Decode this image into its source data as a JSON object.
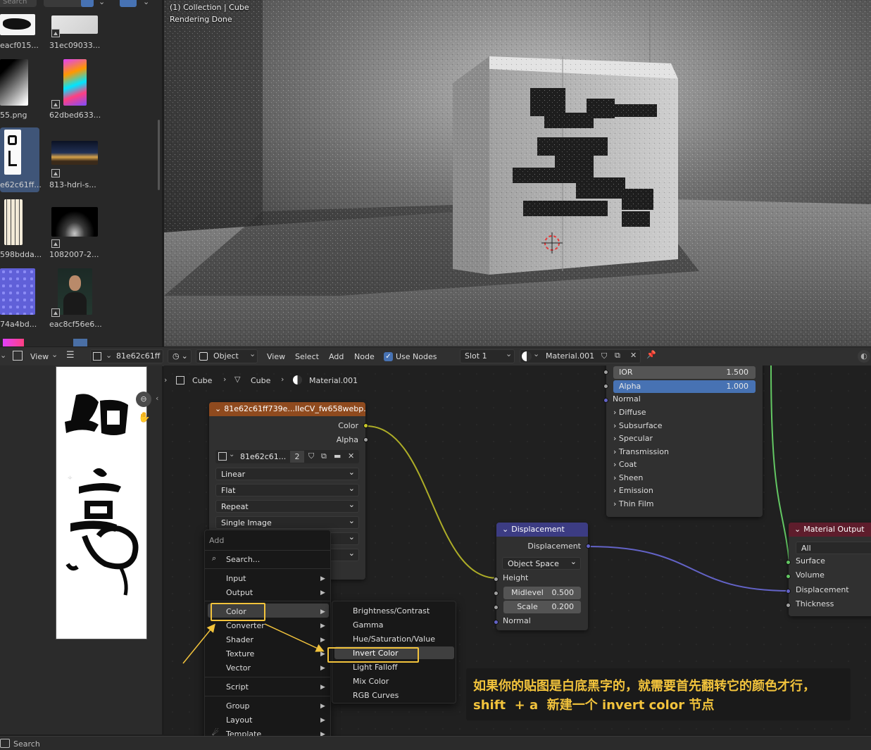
{
  "file_browser": {
    "search_placeholder": "Search",
    "tiles": [
      {
        "label": "eacf015...",
        "thumb": "ink-brush"
      },
      {
        "label": "31ec09033...",
        "thumb": "paper-texture"
      },
      {
        "label": "55.png",
        "thumb": "gradient"
      },
      {
        "label": "62dbed633...",
        "thumb": "colorful-art"
      },
      {
        "label": "e62c61ff...",
        "thumb": "calligraphy",
        "selected": true
      },
      {
        "label": "813-hdri-s...",
        "thumb": "hdri-city"
      },
      {
        "label": "598bdda...",
        "thumb": "scroll-text"
      },
      {
        "label": "1082007-2...",
        "thumb": "spotlight"
      },
      {
        "label": "74a4bd...",
        "thumb": "normal-map"
      },
      {
        "label": "eac8cf56e6...",
        "thumb": "portrait"
      }
    ]
  },
  "viewport": {
    "collection_line": "(1) Collection | Cube",
    "status_line": "Rendering Done"
  },
  "image_editor_header": {
    "view_label": "View",
    "image_name": "81e62c61ff"
  },
  "node_header": {
    "mode": "Object",
    "menus": [
      "View",
      "Select",
      "Add",
      "Node"
    ],
    "use_nodes_label": "Use Nodes",
    "slot": "Slot 1",
    "material": "Material.001"
  },
  "breadcrumb": [
    "Cube",
    "Cube",
    "Material.001"
  ],
  "image_node": {
    "title": "81e62c61ff739e...IIeCV_fw658webp.",
    "outputs": [
      "Color",
      "Alpha"
    ],
    "image_name": "81e62c61...",
    "users": "2",
    "interpolation": "Linear",
    "projection": "Flat",
    "extension": "Repeat",
    "source": "Single Image"
  },
  "bsdf_node": {
    "ior_label": "IOR",
    "ior_value": "1.500",
    "alpha_label": "Alpha",
    "alpha_value": "1.000",
    "normal_label": "Normal",
    "panels": [
      "Diffuse",
      "Subsurface",
      "Specular",
      "Transmission",
      "Coat",
      "Sheen",
      "Emission",
      "Thin Film"
    ]
  },
  "displacement_node": {
    "title": "Displacement",
    "output": "Displacement",
    "space": "Object Space",
    "height_label": "Height",
    "midlevel_label": "Midlevel",
    "midlevel_value": "0.500",
    "scale_label": "Scale",
    "scale_value": "0.200",
    "normal_label": "Normal"
  },
  "material_output_node": {
    "title": "Material Output",
    "target": "All",
    "inputs": [
      "Surface",
      "Volume",
      "Displacement",
      "Thickness"
    ]
  },
  "add_menu": {
    "title": "Add",
    "search_label": "Search...",
    "items": [
      "Input",
      "Output",
      "Color",
      "Converter",
      "Shader",
      "Texture",
      "Vector",
      "Script",
      "Group",
      "Layout",
      "Template"
    ]
  },
  "color_submenu": {
    "items": [
      "Brightness/Contrast",
      "Gamma",
      "Hue/Saturation/Value",
      "Invert Color",
      "Light Falloff",
      "Mix Color",
      "RGB Curves"
    ]
  },
  "annotation": {
    "line1": "如果你的贴图是白底黑字的，就需要首先翻转它的颜色才行，",
    "line2": "shift  + a  新建一个 invert color 节点"
  },
  "status_bar": {
    "search_label": "Search"
  },
  "colors": {
    "accent_blue": "#4772b3",
    "annotation_yellow": "#f2c33c",
    "image_node_header": "#8f4a1e",
    "vector_node_header": "#3c3c83",
    "output_node_header": "#5e1d2c",
    "link_yellow": "#c7c729",
    "link_purple": "#6363c7",
    "link_green": "#63c763"
  }
}
